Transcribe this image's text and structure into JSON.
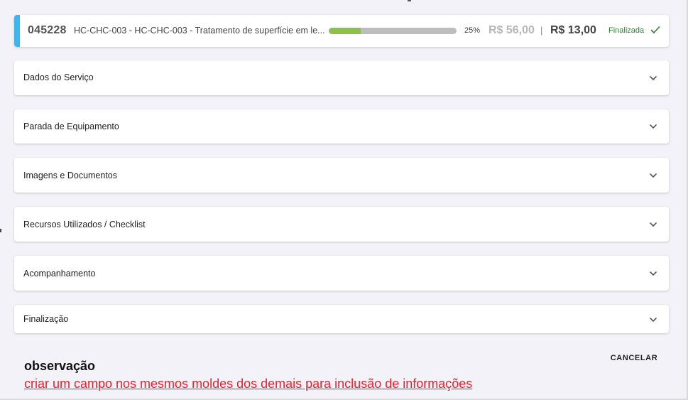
{
  "header": {
    "os_number": "045228",
    "os_title": "HC-CHC-003 - HC-CHC-003 - Tratamento de superfície em le...",
    "progress_percent": 25,
    "progress_label": "25%",
    "price_original": "R$ 56,00",
    "price_separator": "|",
    "price_current": "R$ 13,00",
    "status": "Finalizada",
    "status_icon": "check-icon",
    "accent_color": "#3bb6f0",
    "progress_color": "#8bc34a",
    "status_color": "#2e7d32"
  },
  "panels": [
    {
      "label": "Dados do Serviço",
      "icon": "chevron-down-icon"
    },
    {
      "label": "Parada de Equipamento",
      "icon": "chevron-down-icon"
    },
    {
      "label": "Imagens e Documentos",
      "icon": "chevron-down-icon"
    },
    {
      "label": "Recursos Utilizados / Checklist",
      "icon": "chevron-down-icon"
    },
    {
      "label": "Acompanhamento",
      "icon": "chevron-down-icon"
    },
    {
      "label": "Finalização",
      "icon": "chevron-down-icon"
    }
  ],
  "footer": {
    "cancel_label": "CANCELAR"
  },
  "annotation": {
    "title": "observação",
    "text": "criar um campo nos mesmos moldes dos demais para inclusão de informações",
    "text_color": "#e8202a"
  }
}
